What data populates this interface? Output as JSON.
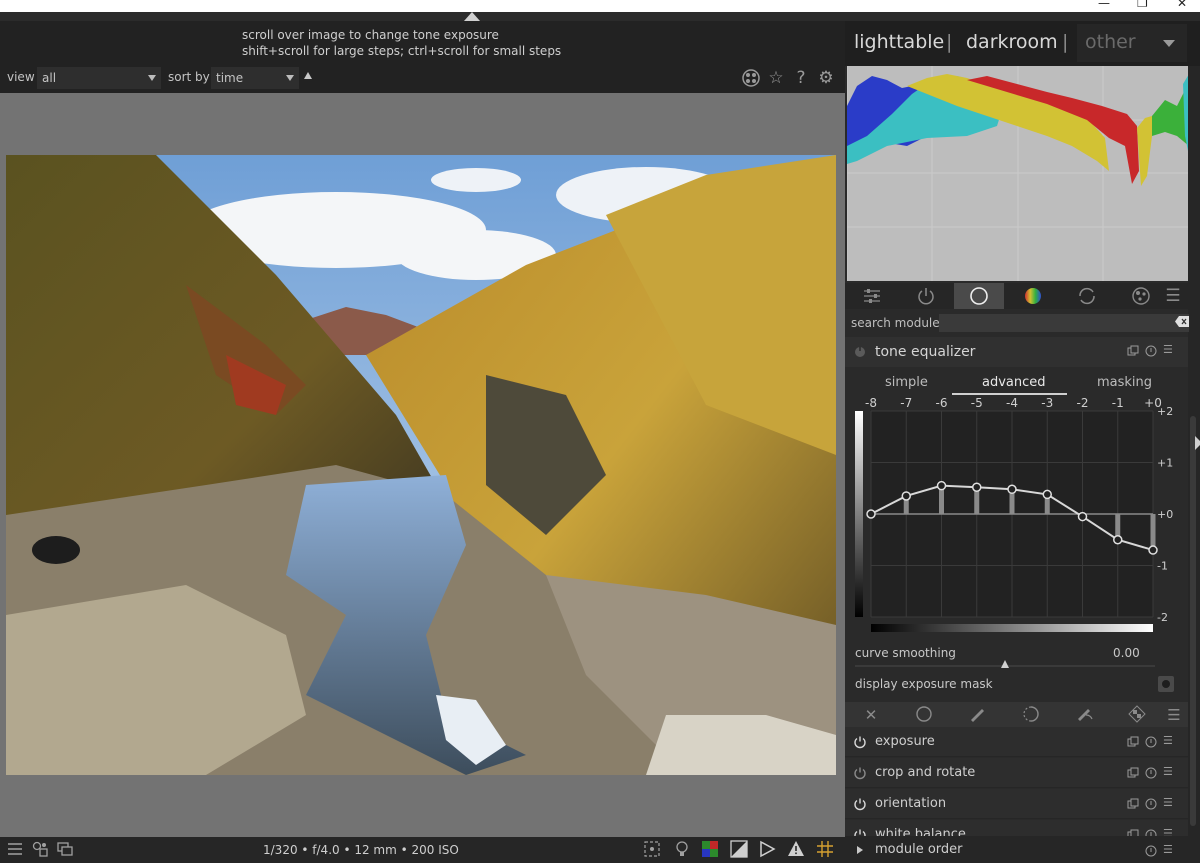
{
  "window": {
    "minimize": "—",
    "maximize": "❐",
    "close": "✕"
  },
  "hint": {
    "line1": "scroll over image to change tone exposure",
    "line2": "shift+scroll for large steps; ctrl+scroll for small steps"
  },
  "filter": {
    "view_label": "view",
    "view_value": "all",
    "sort_label": "sort by",
    "sort_value": "time"
  },
  "views": {
    "lighttable": "lighttable",
    "sep1": "|",
    "darkroom": "darkroom",
    "sep2": "|",
    "other": "other"
  },
  "exif": "1/320 • f/4.0 • 12 mm • 200 ISO",
  "search": {
    "label": "search module",
    "value": ""
  },
  "tone_equalizer": {
    "title": "tone equalizer",
    "tabs": [
      "simple",
      "advanced",
      "masking"
    ],
    "active_tab": "advanced",
    "x_ticks": [
      "-8",
      "-7",
      "-6",
      "-5",
      "-4",
      "-3",
      "-2",
      "-1",
      "+0"
    ],
    "y_ticks": [
      "+2",
      "+1",
      "+0",
      "-1",
      "-2"
    ],
    "nodes_ev": [
      0.0,
      0.35,
      0.55,
      0.52,
      0.48,
      0.38,
      -0.05,
      -0.5,
      -0.7
    ],
    "curve_smoothing_label": "curve smoothing",
    "curve_smoothing_value": "0.00",
    "display_mask_label": "display exposure mask"
  },
  "modules": [
    {
      "name": "exposure"
    },
    {
      "name": "crop and rotate"
    },
    {
      "name": "orientation"
    },
    {
      "name": "white balance"
    }
  ],
  "module_order_label": "module order",
  "icon_glyphs": {
    "help": "?",
    "star": "☆",
    "gear": "⚙",
    "menu": "☰",
    "close": "✕"
  }
}
